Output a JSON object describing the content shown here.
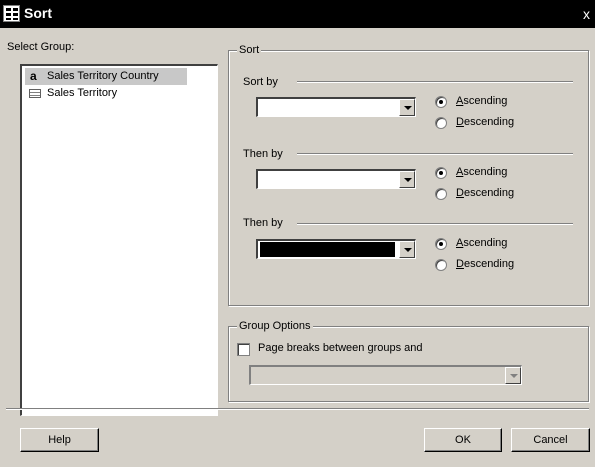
{
  "window": {
    "title": "Sort",
    "close_glyph": "x"
  },
  "select_group": {
    "label": "Select Group:",
    "items": [
      {
        "icon": "a",
        "label": "Sales Territory Country",
        "selected": true
      },
      {
        "icon": "table-icon",
        "label": "Sales Territory",
        "selected": false
      }
    ]
  },
  "sort": {
    "title": "Sort",
    "blocks": [
      {
        "label": "Sort by",
        "value": "",
        "ascending": "Ascending",
        "asc_key": "A",
        "asc_rest": "scending",
        "descending": "Descending",
        "desc_key": "D",
        "desc_rest": "escending",
        "selected": "ascending"
      },
      {
        "label": "Then by",
        "value": "",
        "ascending": "Ascending",
        "asc_key": "A",
        "asc_rest": "scending",
        "descending": "Descending",
        "desc_key": "D",
        "desc_rest": "escending",
        "selected": "ascending"
      },
      {
        "label": "Then by",
        "value": "",
        "ascending": "Ascending",
        "asc_key": "A",
        "asc_rest": "scending",
        "descending": "Descending",
        "desc_key": "D",
        "desc_rest": "escending",
        "selected": "ascending"
      }
    ]
  },
  "group_options": {
    "title": "Group Options",
    "page_breaks_label": "Page breaks between groups and",
    "page_breaks_checked": false,
    "page_breaks_value": ""
  },
  "buttons": {
    "help": "Help",
    "ok": "OK",
    "cancel": "Cancel"
  }
}
